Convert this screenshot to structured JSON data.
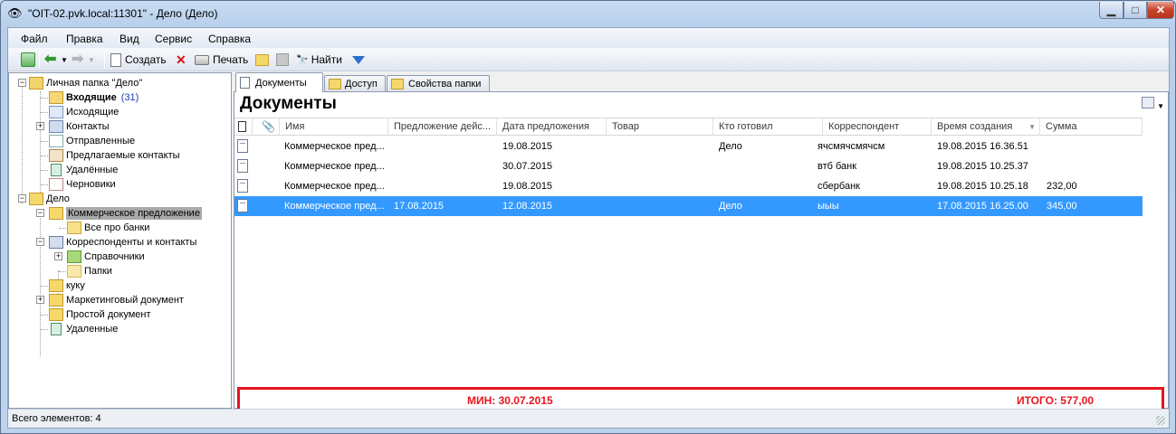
{
  "window": {
    "title": "\"OIT-02.pvk.local:11301\" - Дело (Дело)",
    "close_glyph": "✕",
    "minimize_glyph": "▁",
    "maximize_glyph": "□"
  },
  "menu": [
    {
      "label": "Файл"
    },
    {
      "label": "Правка"
    },
    {
      "label": "Вид"
    },
    {
      "label": "Сервис"
    },
    {
      "label": "Справка"
    }
  ],
  "toolbar": {
    "create_label": "Создать",
    "print_label": "Печать",
    "find_label": "Найти"
  },
  "tree": {
    "personal_folder": "Личная папка \"Дело\"",
    "inbox": "Входящие",
    "inbox_count": "(31)",
    "outgoing": "Исходящие",
    "contacts": "Контакты",
    "sent": "Отправленные",
    "suggested_contacts": "Предлагаемые контакты",
    "deleted": "Удалённые",
    "drafts": "Черновики",
    "delo": "Дело",
    "commercial_offer": "Коммерческое предложение",
    "all_about_banks": "Все про банки",
    "correspondents": "Корреспонденты и контакты",
    "reference": "Справочники",
    "folders": "Папки",
    "kuku": "куку",
    "marketing_doc": "Маркетинговый документ",
    "simple_doc": "Простой документ",
    "removed": "Удаленные"
  },
  "tabs": [
    {
      "label": "Документы"
    },
    {
      "label": "Доступ"
    },
    {
      "label": "Свойства папки"
    }
  ],
  "documents": {
    "title": "Документы",
    "columns": {
      "name": "Имя",
      "offer_action": "Предложение дейс...",
      "offer_date": "Дата предложения",
      "product": "Товар",
      "prepared_by": "Кто готовил",
      "correspondent": "Корреспондент",
      "created": "Время создания",
      "sum": "Сумма"
    },
    "rows": [
      {
        "name": "Коммерческое пред...",
        "offer_action": "",
        "offer_date": "19.08.2015",
        "product": "",
        "prepared_by": "Дело",
        "correspondent": "ячсмячсмячсм",
        "created": "19.08.2015 16.36.51",
        "sum": ""
      },
      {
        "name": "Коммерческое пред...",
        "offer_action": "",
        "offer_date": "30.07.2015",
        "product": "",
        "prepared_by": "",
        "correspondent": "втб банк",
        "created": "19.08.2015 10.25.37",
        "sum": ""
      },
      {
        "name": "Коммерческое пред...",
        "offer_action": "",
        "offer_date": "19.08.2015",
        "product": "",
        "prepared_by": "",
        "correspondent": "сбербанк",
        "created": "19.08.2015 10.25.18",
        "sum": "232,00"
      },
      {
        "name": "Коммерческое пред...",
        "offer_action": "17.08.2015",
        "offer_date": "12.08.2015",
        "product": "",
        "prepared_by": "Дело",
        "correspondent": "ыыы",
        "created": "17.08.2015 16.25.00",
        "sum": "345,00",
        "selected": true
      }
    ],
    "summary_min": "МИН: 30.07.2015",
    "summary_total": "ИТОГО: 577,00"
  },
  "status": {
    "text": "Всего элементов: 4"
  },
  "colors": {
    "selection": "#3399ff",
    "summary_accent": "#e8141e"
  }
}
